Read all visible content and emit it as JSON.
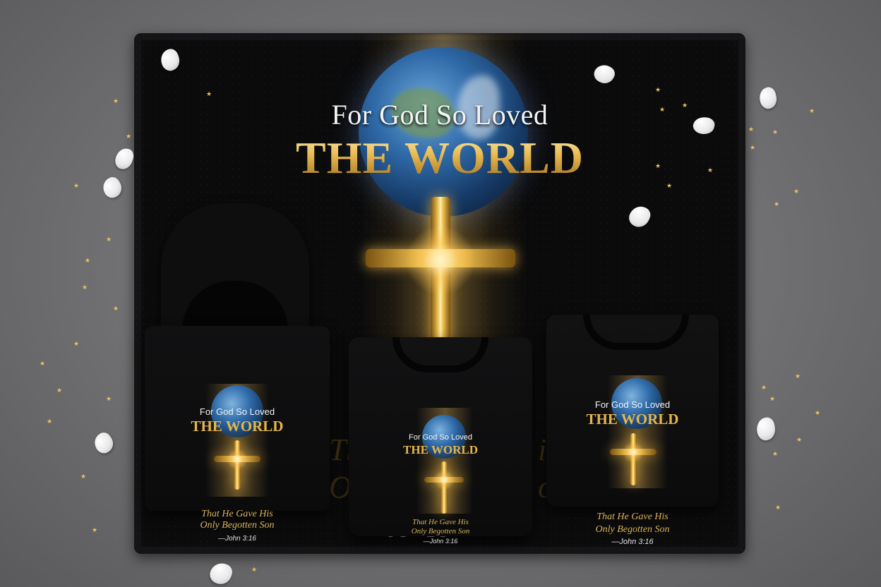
{
  "blanket": {
    "headline_line1": "For God So Loved",
    "headline_line2": "THE WORLD",
    "ghost_line1": "Th",
    "ghost_line2": "On",
    "ghost_right1": "is",
    "ghost_right2": "on",
    "reference": "Jo    ·16"
  },
  "hoodie_print": {
    "line1": "For God So Loved",
    "line2": "THE WORLD",
    "verse_line1": "That He Gave His",
    "verse_line2": "Only Begotten Son",
    "reference": "—John 3:16"
  },
  "tee_center_print": {
    "line1": "For God So Loved",
    "line2": "THE WORLD",
    "verse_line1": "That He Gave His",
    "verse_line2": "Only Begotten Son",
    "reference": "—John 3:16"
  },
  "tee_right_print": {
    "line1": "For God So Loved",
    "line2": "THE WORLD",
    "verse_line1": "That He Gave His",
    "verse_line2": "Only Begotten Son",
    "reference": "—John 3:16"
  },
  "colors": {
    "background": "#707072",
    "fabric": "#0b0b0c",
    "gold": "#e2b447",
    "text_white": "#f2f2f2"
  },
  "icons": [
    "cross-icon",
    "globe-icon",
    "star-confetti-icon",
    "petal-icon"
  ]
}
